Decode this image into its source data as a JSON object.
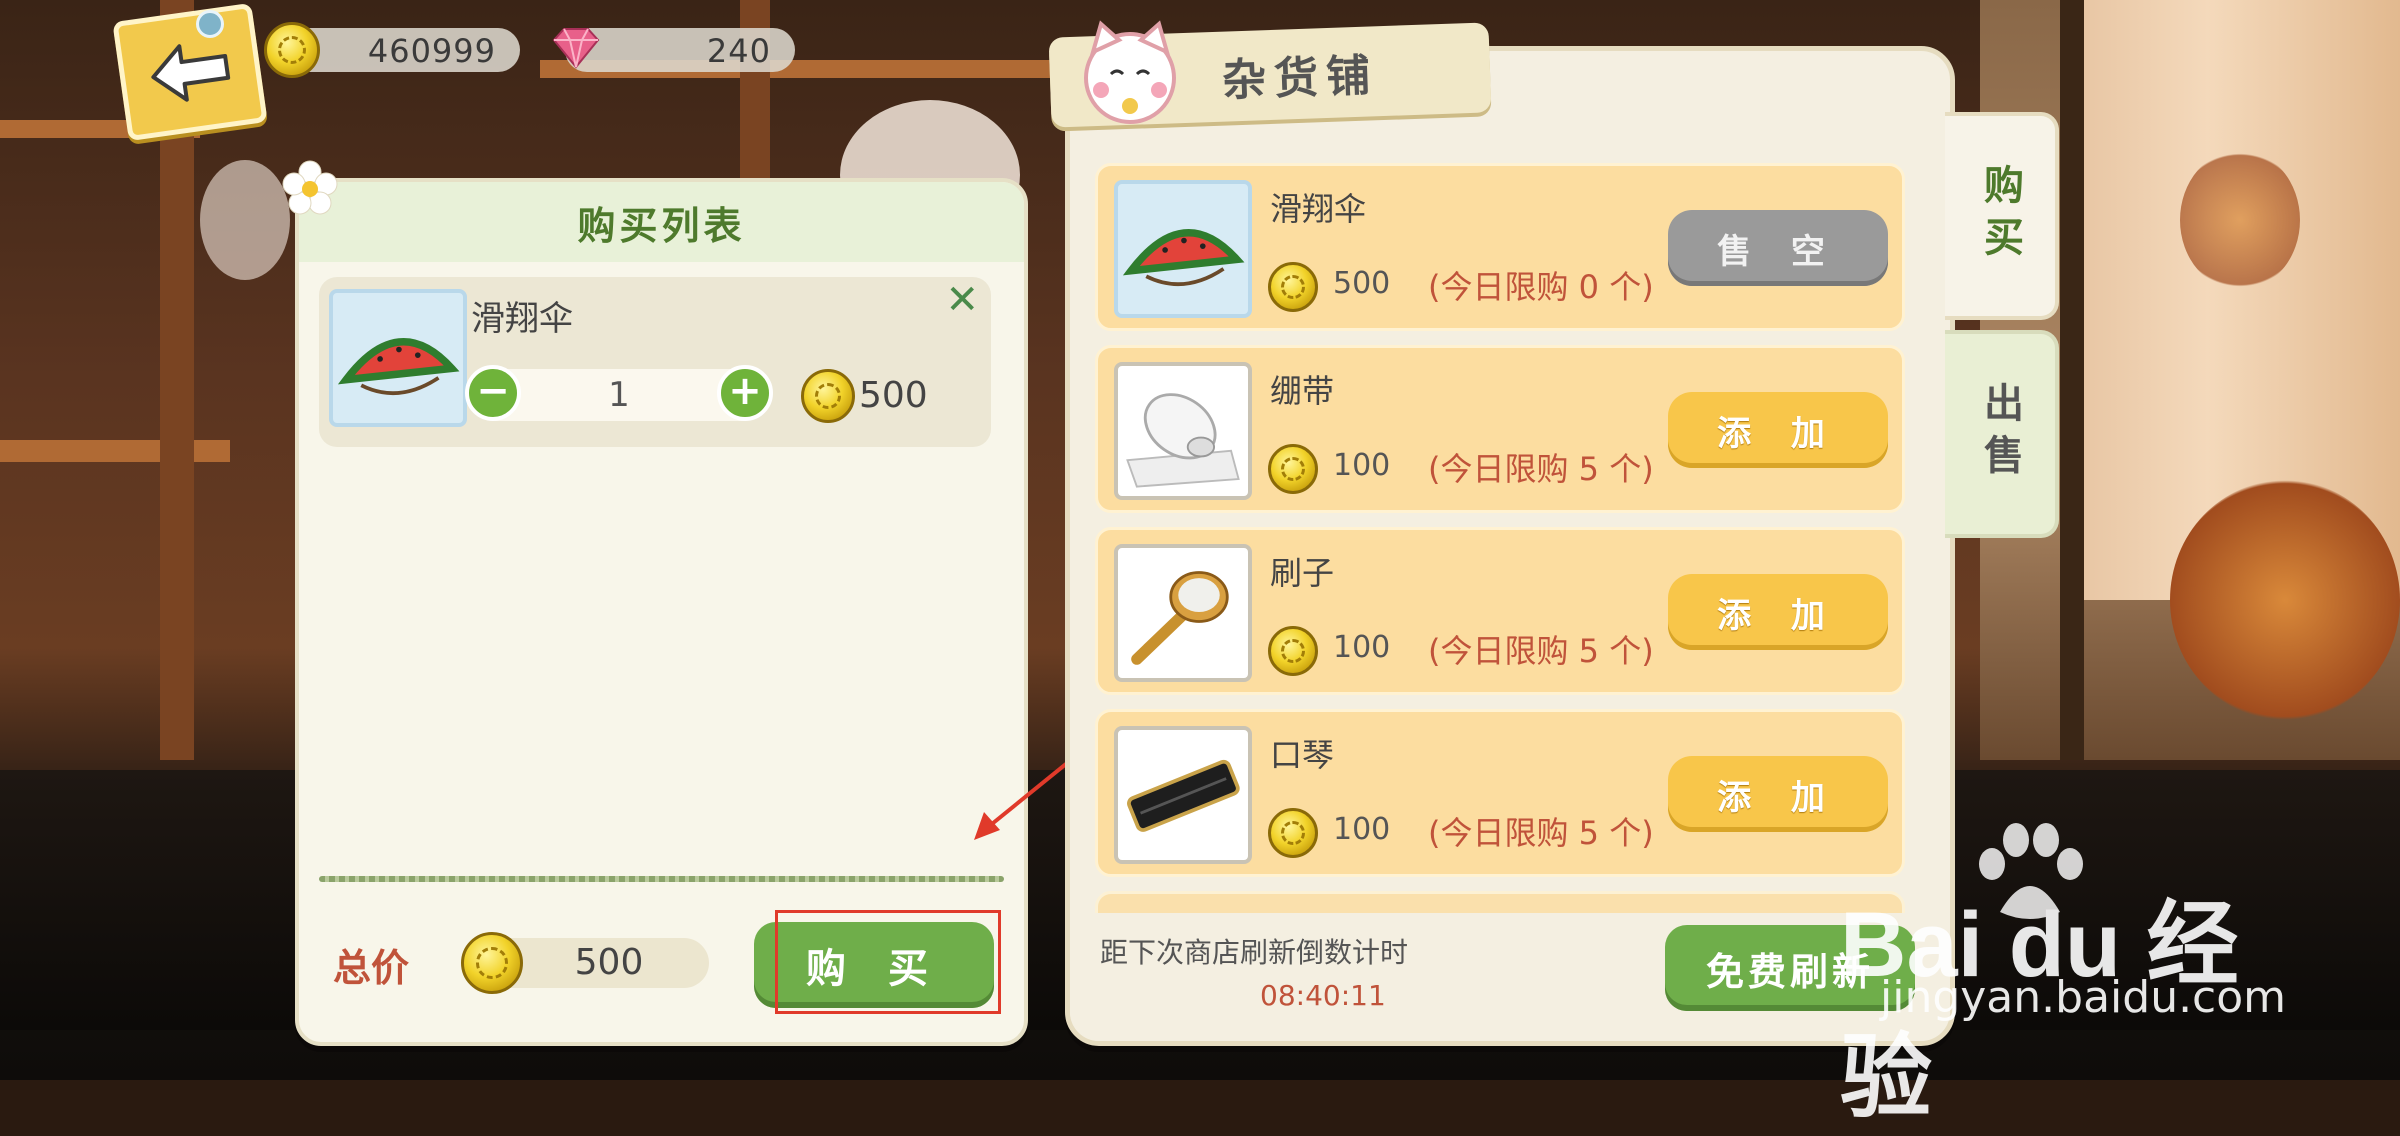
{
  "currency": {
    "coins": "460999",
    "gems": "240"
  },
  "cart": {
    "title": "购买列表",
    "items": [
      {
        "name": "滑翔伞",
        "qty": "1",
        "price": "500"
      }
    ],
    "total_label": "总价",
    "total": "500",
    "buy_label": "购 买"
  },
  "shop": {
    "title": "杂货铺",
    "items": [
      {
        "name": "滑翔伞",
        "price": "500",
        "limit": "(今日限购  0 个)",
        "action": "售 空",
        "state": "sold-out"
      },
      {
        "name": "绷带",
        "price": "100",
        "limit": "(今日限购  5 个)",
        "action": "添 加",
        "state": "available"
      },
      {
        "name": "刷子",
        "price": "100",
        "limit": "(今日限购  5 个)",
        "action": "添 加",
        "state": "available"
      },
      {
        "name": "口琴",
        "price": "100",
        "limit": "(今日限购  5 个)",
        "action": "添 加",
        "state": "available"
      }
    ],
    "refresh_label": "距下次商店刷新倒数计时",
    "refresh_timer": "08:40:11",
    "refresh_button": "免费刷新"
  },
  "tabs": {
    "buy": "购买",
    "sell": "出售"
  },
  "watermark": {
    "brand": "Bai  du 经验",
    "url": "jingyan.baidu.com"
  },
  "colors": {
    "green": "#6fae4a",
    "yellow": "#f8c64a",
    "red_text": "#c0533a",
    "annotation": "#e03a2a"
  },
  "icons": [
    "back-arrow-icon",
    "coin-icon",
    "gem-icon",
    "remove-icon",
    "minus-icon",
    "plus-icon",
    "lucky-cat-icon",
    "paw-icon"
  ]
}
